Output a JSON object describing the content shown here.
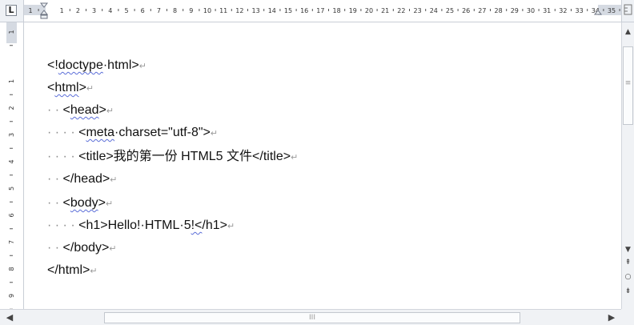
{
  "ruler": {
    "tab_selector": "L",
    "h_numbers": [
      "1",
      "1",
      "2",
      "3",
      "4",
      "5",
      "6",
      "7",
      "8",
      "9",
      "10",
      "11",
      "12",
      "13",
      "14",
      "15",
      "16",
      "17",
      "18",
      "19",
      "20",
      "21",
      "22",
      "23",
      "24",
      "25",
      "26",
      "27",
      "28",
      "29",
      "30",
      "31",
      "32",
      "33",
      "34",
      "35"
    ],
    "v_numbers": [
      "1",
      "1",
      "2",
      "3",
      "4",
      "5",
      "6",
      "7",
      "8",
      "9",
      "10"
    ]
  },
  "document": {
    "lines": [
      {
        "indent": "",
        "parts": [
          {
            "t": "<!",
            "s": false
          },
          {
            "t": "doctype",
            "s": true
          },
          {
            "t": "·html>",
            "s": false
          }
        ]
      },
      {
        "indent": "",
        "parts": [
          {
            "t": "<",
            "s": false
          },
          {
            "t": "html",
            "s": true
          },
          {
            "t": ">",
            "s": false
          }
        ]
      },
      {
        "indent": "··",
        "parts": [
          {
            "t": "<",
            "s": false
          },
          {
            "t": "head",
            "s": true
          },
          {
            "t": ">",
            "s": false
          }
        ]
      },
      {
        "indent": "····",
        "parts": [
          {
            "t": "<",
            "s": false
          },
          {
            "t": "meta",
            "s": true
          },
          {
            "t": "·charset=\"utf-8\">",
            "s": false
          }
        ]
      },
      {
        "indent": "····",
        "parts": [
          {
            "t": "<title>我的第一份 HTML5 文件</title>",
            "s": false
          }
        ]
      },
      {
        "indent": "··",
        "parts": [
          {
            "t": "</head>",
            "s": false
          }
        ]
      },
      {
        "indent": "··",
        "parts": [
          {
            "t": "<",
            "s": false
          },
          {
            "t": "body",
            "s": true
          },
          {
            "t": ">",
            "s": false
          }
        ]
      },
      {
        "indent": "····",
        "parts": [
          {
            "t": "<h1>Hello!·HTML·5",
            "s": false
          },
          {
            "t": "!<",
            "s": true
          },
          {
            "t": "/h1>",
            "s": false
          }
        ]
      },
      {
        "indent": "··",
        "parts": [
          {
            "t": "</body>",
            "s": false
          }
        ]
      },
      {
        "indent": "",
        "parts": [
          {
            "t": "</html>",
            "s": false
          }
        ]
      }
    ],
    "paragraph_mark": "↵"
  },
  "scrollbar": {
    "up": "▲",
    "down": "▼",
    "prev_page": "⇞",
    "select_browse": "○",
    "next_page": "⇟",
    "left": "◀",
    "right": "▶",
    "h_thumb_grip": "III",
    "v_thumb_grip": "≡"
  }
}
